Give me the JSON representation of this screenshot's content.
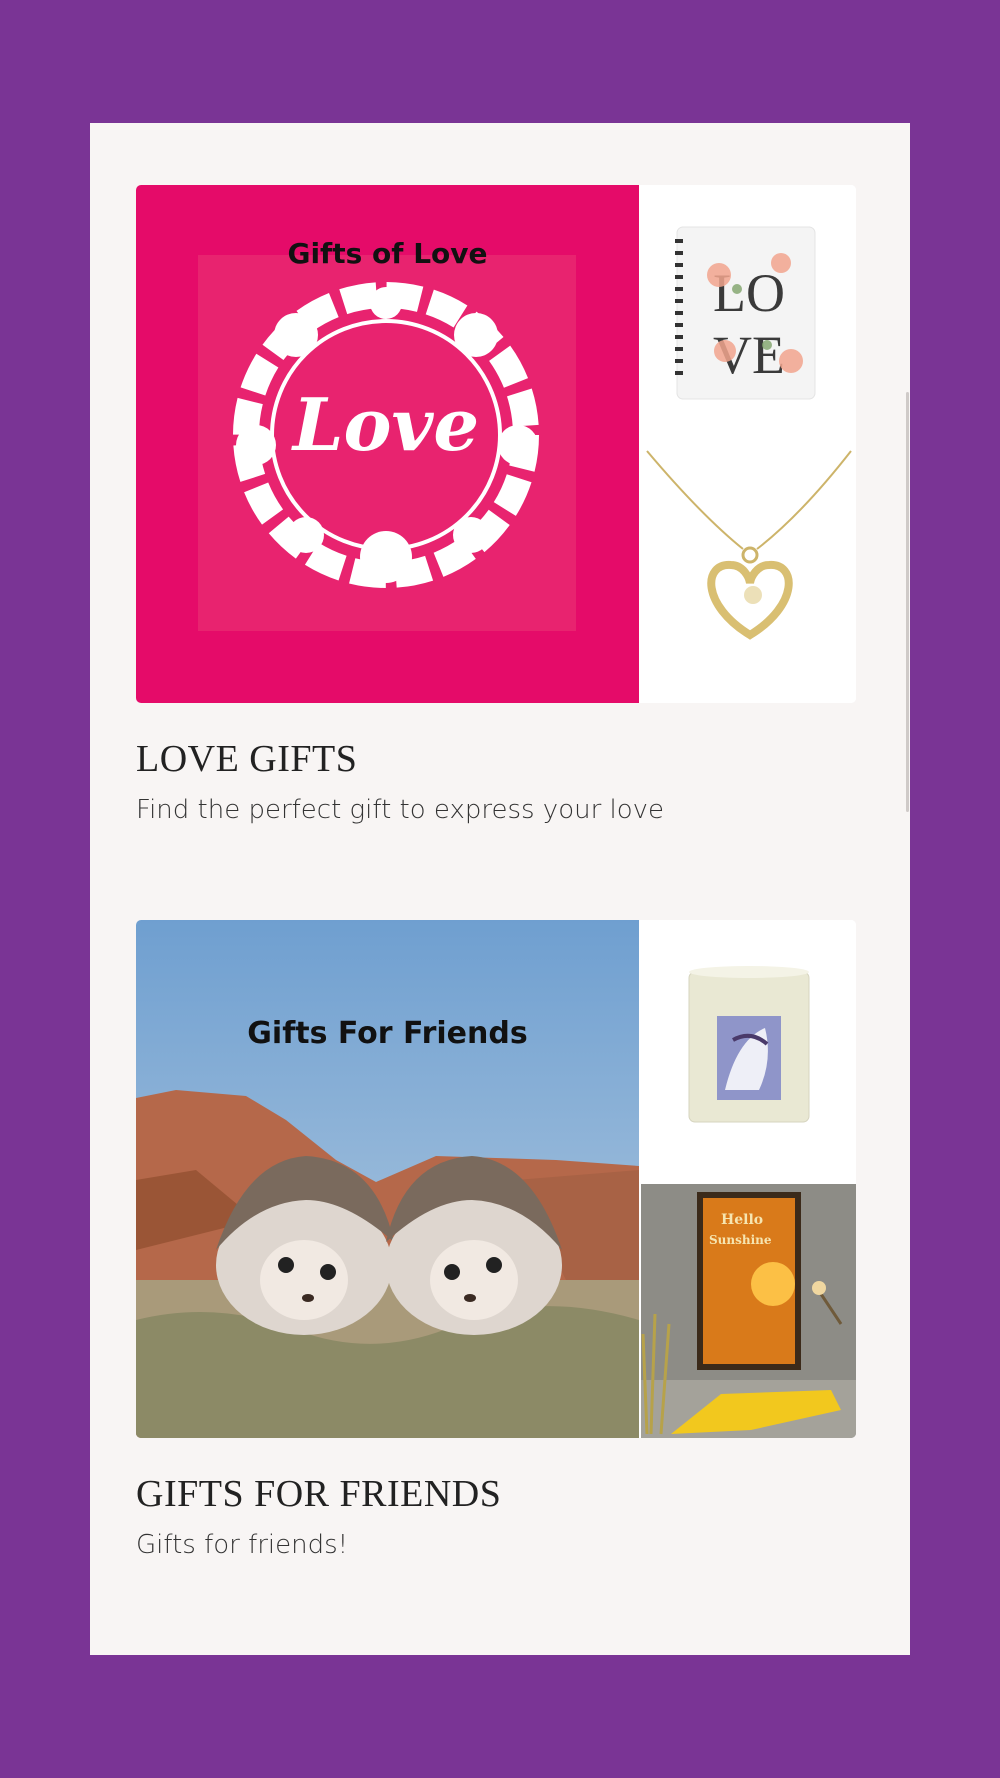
{
  "collections": [
    {
      "image_caption": "Gifts of Love",
      "title": "LOVE GIFTS",
      "description": "Find the perfect gift to express your love",
      "accent": "#e50b69",
      "icons": [
        "love-wreath-image",
        "love-notebook-image",
        "heart-necklace-image"
      ]
    },
    {
      "image_caption": "Gifts For Friends",
      "title": "GIFTS FOR FRIENDS",
      "description": "Gifts for friends!",
      "accent": "#7aa6d2",
      "icons": [
        "hedgehogs-image",
        "unicorn-candle-image",
        "sunshine-poster-image"
      ]
    }
  ]
}
